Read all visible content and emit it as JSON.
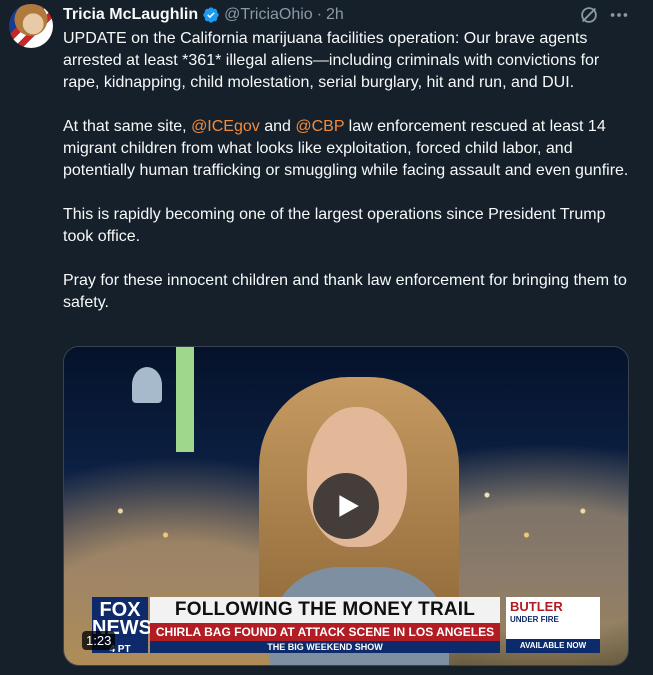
{
  "author": {
    "name": "Tricia McLaughlin",
    "handle": "@TriciaOhio",
    "separator": "·",
    "time": "2h"
  },
  "icons": {
    "verified": "verified-badge-icon",
    "grok": "grok-icon",
    "more": "more-options-icon",
    "play": "play-icon"
  },
  "colors": {
    "background": "#15202b",
    "mention": "#f28b3c",
    "verified": "#1d9bf0",
    "muted_text": "#8b98a5"
  },
  "tweet": {
    "p1": "UPDATE on the California marijuana facilities operation: Our brave agents arrested at least *361* illegal aliens—including criminals with convictions for rape, kidnapping, child molestation, serial burglary, hit and run, and DUI.",
    "p2_before": "At that same site, ",
    "mention1": "@ICEgov",
    "p2_and": " and ",
    "mention2": "@CBP",
    "p2_after": " law enforcement rescued at least 14 migrant children from what looks like exploitation, forced child labor, and potentially human trafficking or smuggling while facing assault and even gunfire.",
    "p3": "This is rapidly becoming one of the largest operations since President Trump took office.",
    "p4": "Pray for these innocent children and thank law enforcement for bringing them to safety."
  },
  "video": {
    "duration": "1:23",
    "chyron": {
      "logo_line1": "FOX",
      "logo_line2": "NEWS",
      "logo_time": "4 PT",
      "headline": "FOLLOWING THE MONEY TRAIL",
      "subhead": "CHIRLA BAG FOUND AT ATTACK SCENE IN LOS ANGELES",
      "show": "THE BIG WEEKEND SHOW",
      "promo_title": "BUTLER",
      "promo_sub": "UNDER FIRE",
      "promo_avail": "AVAILABLE NOW"
    }
  }
}
